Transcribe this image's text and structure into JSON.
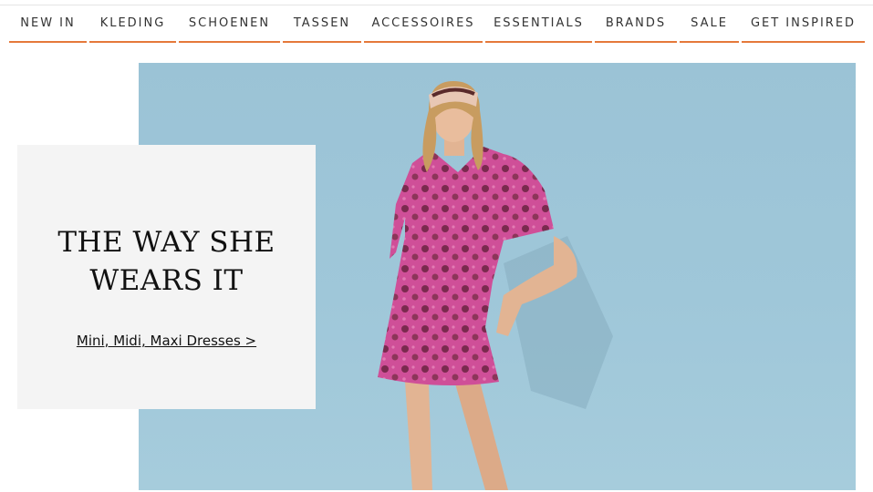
{
  "nav": {
    "items": [
      {
        "label": "NEW IN"
      },
      {
        "label": "KLEDING"
      },
      {
        "label": "SCHOENEN"
      },
      {
        "label": "TASSEN"
      },
      {
        "label": "ACCESSOIRES"
      },
      {
        "label": "ESSENTIALS"
      },
      {
        "label": "BRANDS"
      },
      {
        "label": "SALE"
      },
      {
        "label": "GET INSPIRED"
      }
    ],
    "underline_color": "#e5793a"
  },
  "hero": {
    "background_color": "#9fc7d9",
    "dress_color": "#d0509a"
  },
  "promo": {
    "title": "THE WAY SHE\nWEARS IT",
    "link_label": "Mini, Midi, Maxi Dresses >"
  }
}
